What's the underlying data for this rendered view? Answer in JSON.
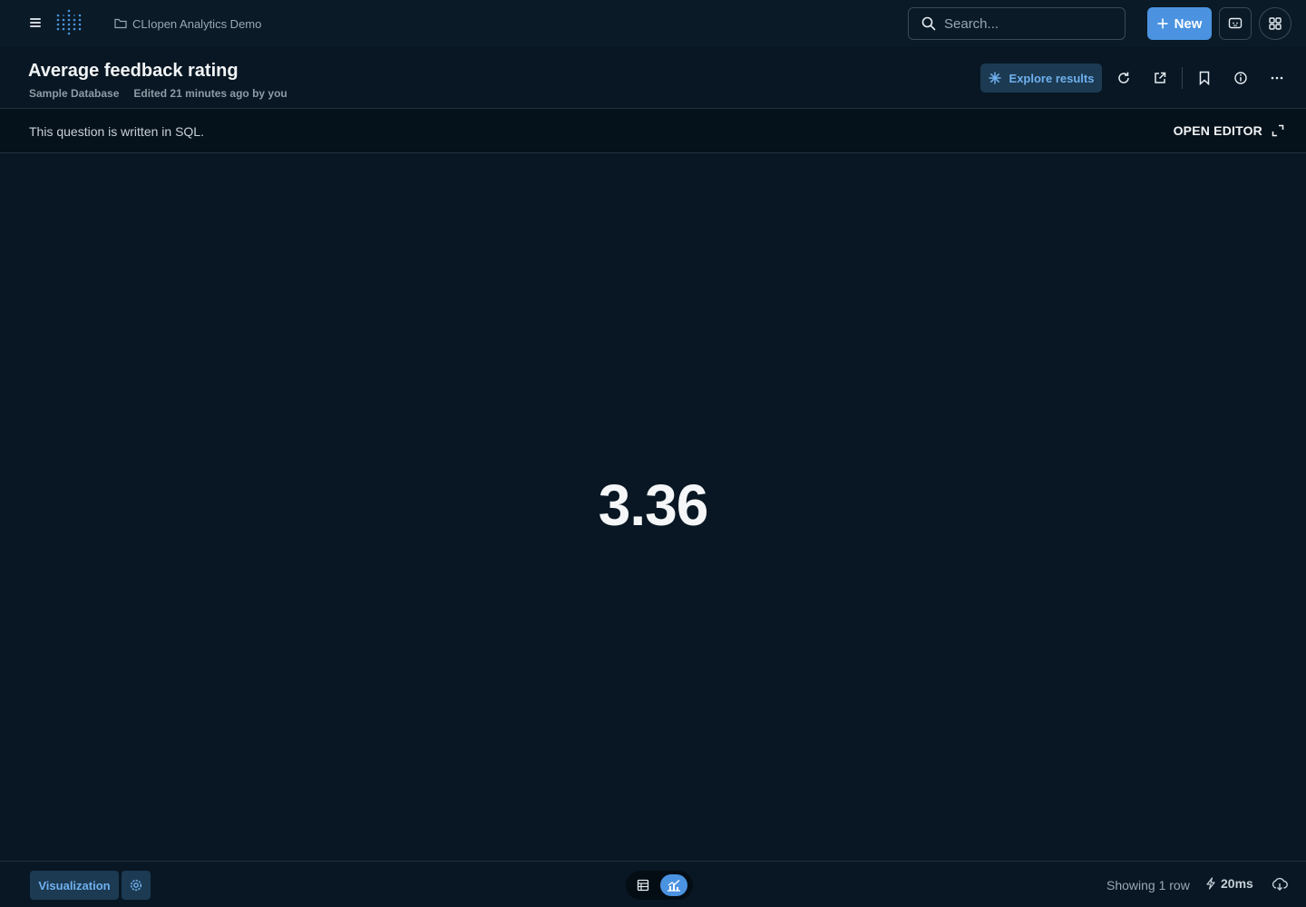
{
  "nav": {
    "breadcrumb": "CLIopen Analytics Demo",
    "search_placeholder": "Search...",
    "new_label": "New"
  },
  "question": {
    "title": "Average feedback rating",
    "database": "Sample Database",
    "edited": "Edited 21 minutes ago by you",
    "explore_label": "Explore results"
  },
  "sql": {
    "note": "This question is written in SQL.",
    "open_editor_label": "OPEN EDITOR"
  },
  "result": {
    "value": "3.36"
  },
  "footer": {
    "visualization_label": "Visualization",
    "row_count": "Showing 1 row",
    "timing": "20ms"
  },
  "icons": {
    "hamburger": "menu-icon",
    "logo": "logo-icon",
    "folder": "folder-icon",
    "search": "search-icon",
    "plus": "plus-icon",
    "chat": "chat-icon",
    "apps": "grid-icon",
    "sparkle": "sparkle-icon",
    "refresh": "refresh-icon",
    "share": "share-icon",
    "bookmark": "bookmark-icon",
    "info": "info-icon",
    "more": "more-icon",
    "expand": "expand-icon",
    "gear": "gear-icon",
    "table": "table-icon",
    "chart": "chart-icon",
    "bolt": "bolt-icon",
    "download": "download-icon"
  },
  "colors": {
    "background": "#081723",
    "accent": "#4b93e0",
    "accent_muted": "#1c3a52"
  }
}
